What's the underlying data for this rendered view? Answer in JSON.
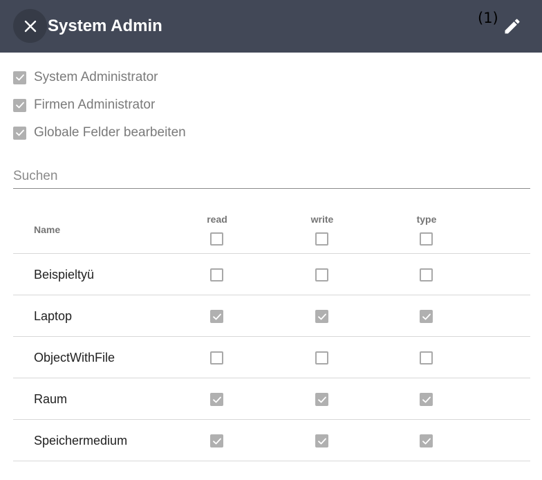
{
  "header": {
    "title": "System Admin",
    "count": "(1)",
    "background": "#424857"
  },
  "permissions": [
    {
      "label": "System Administrator",
      "checked": true
    },
    {
      "label": "Firmen Administrator",
      "checked": true
    },
    {
      "label": "Globale Felder bearbeiten",
      "checked": true
    }
  ],
  "search": {
    "placeholder": "Suchen",
    "value": ""
  },
  "table": {
    "headers": {
      "name": "Name",
      "read": "read",
      "write": "write",
      "type": "type"
    },
    "header_checks": {
      "read": false,
      "write": false,
      "type": false
    },
    "rows": [
      {
        "name": "Beispieltyü",
        "read": false,
        "write": false,
        "type": false
      },
      {
        "name": "Laptop",
        "read": true,
        "write": true,
        "type": true
      },
      {
        "name": "ObjectWithFile",
        "read": false,
        "write": false,
        "type": false
      },
      {
        "name": "Raum",
        "read": true,
        "write": true,
        "type": true
      },
      {
        "name": "Speichermedium",
        "read": true,
        "write": true,
        "type": true
      }
    ]
  }
}
